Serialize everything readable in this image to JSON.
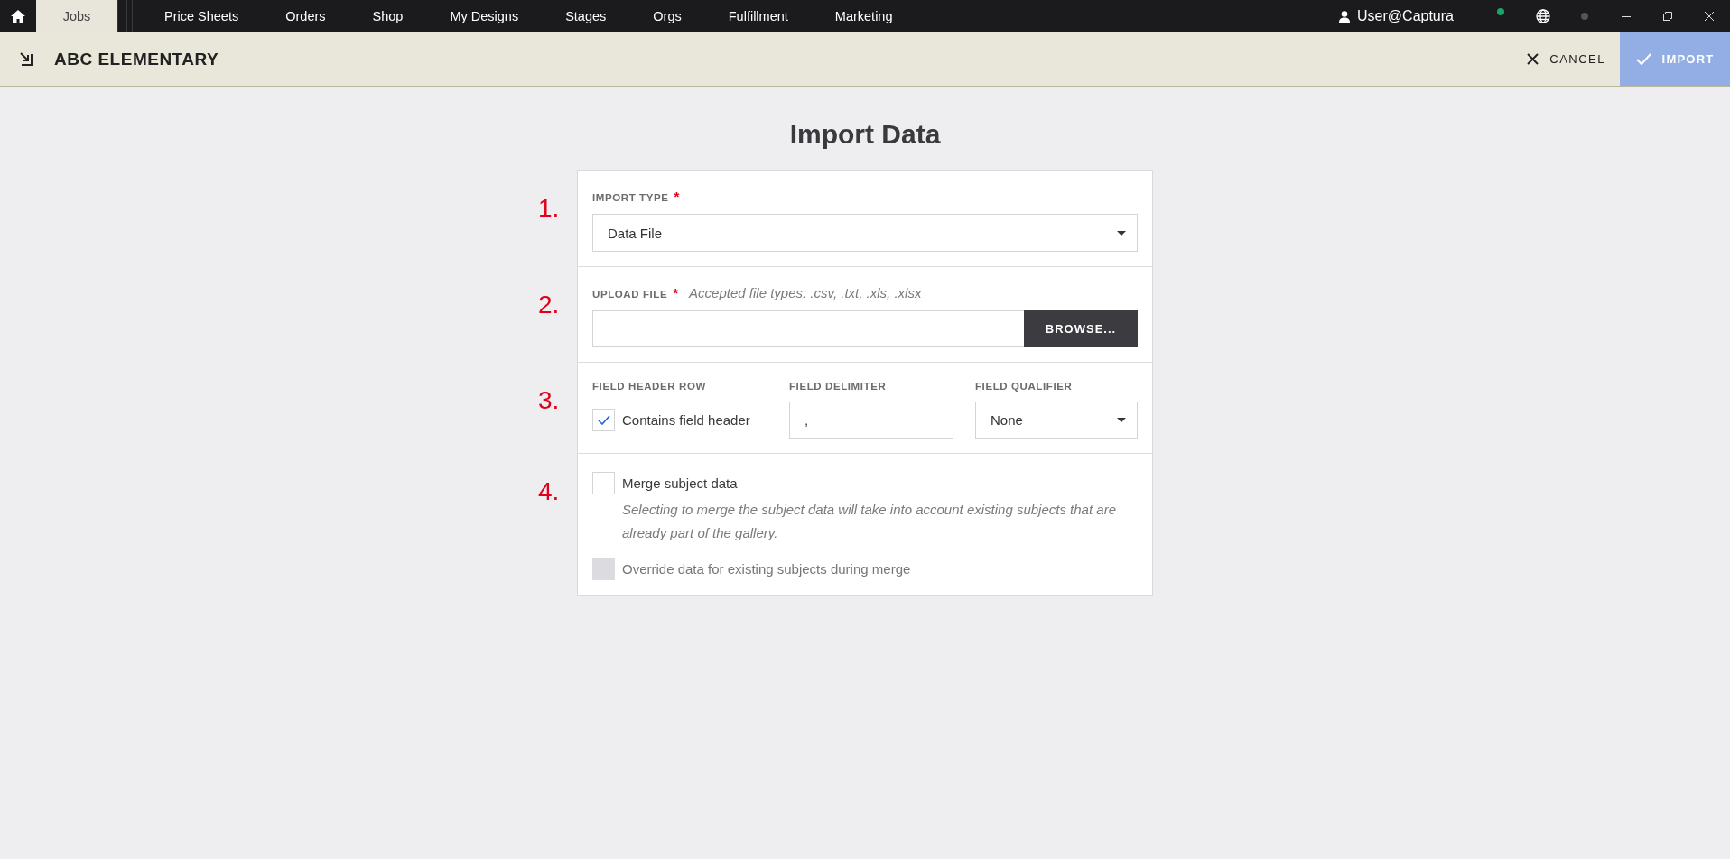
{
  "nav": {
    "tabs": [
      {
        "label": "Jobs",
        "selected": true
      },
      {
        "label": "Price Sheets",
        "selected": false
      },
      {
        "label": "Orders",
        "selected": false
      },
      {
        "label": "Shop",
        "selected": false
      },
      {
        "label": "My Designs",
        "selected": false
      },
      {
        "label": "Stages",
        "selected": false
      },
      {
        "label": "Orgs",
        "selected": false
      },
      {
        "label": "Fulfillment",
        "selected": false
      },
      {
        "label": "Marketing",
        "selected": false
      }
    ],
    "user": "User@Captura"
  },
  "header": {
    "title": "ABC ELEMENTARY",
    "cancel": "CANCEL",
    "import": {
      "label": "IMPORT",
      "disabled": true
    }
  },
  "page_title": "Import Data",
  "sections": [
    {
      "marker": "1.",
      "kind": "select",
      "label": "IMPORT TYPE",
      "required_mark": "*",
      "value": "Data File"
    },
    {
      "marker": "2.",
      "kind": "upload",
      "label": "UPLOAD FILE",
      "required_mark": "*",
      "hint": "Accepted file types: .csv, .txt, .xls, .xlsx",
      "button": "BROWSE..."
    },
    {
      "marker": "3.",
      "kind": "fields",
      "header_row": {
        "label": "FIELD HEADER ROW",
        "checkbox": {
          "label": "Contains field header",
          "checked": true
        }
      },
      "delimiter": {
        "label": "FIELD DELIMITER",
        "value": ","
      },
      "qualifier": {
        "label": "FIELD QUALIFIER",
        "value": "None"
      }
    },
    {
      "marker": "4.",
      "kind": "merge",
      "options": [
        {
          "label": "Merge subject data",
          "checked": false,
          "disabled": false,
          "description": "Selecting to merge the subject data will take into account existing subjects that are already part of the gallery."
        },
        {
          "label": "Override data for existing subjects during merge",
          "checked": false,
          "disabled": true
        }
      ]
    }
  ]
}
